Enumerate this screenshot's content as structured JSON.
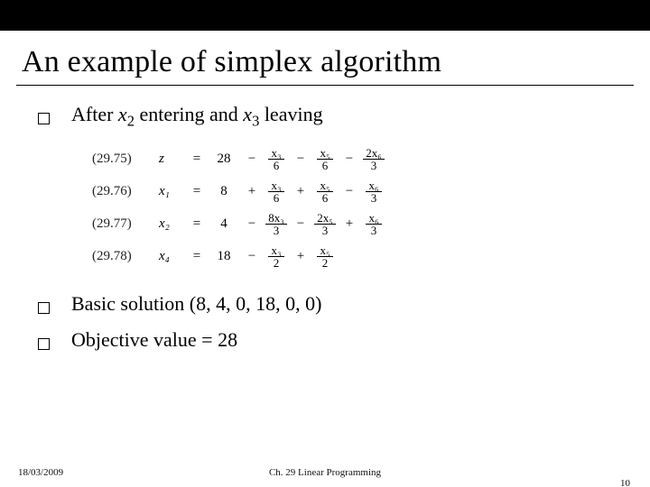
{
  "title": "An example of simplex algorithm",
  "bullets": {
    "b1_prefix": "After ",
    "b1_x2": "x",
    "b1_x2_sub": "2",
    "b1_mid": " entering and   ",
    "b1_x3": "x",
    "b1_x3_sub": "3",
    "b1_suffix": "   leaving",
    "b2": "Basic solution (8, 4, 0, 18, 0, 0)",
    "b3": "Objective value = 28"
  },
  "equations": [
    {
      "label": "(29.75)",
      "var": "z",
      "const": "28",
      "terms": [
        {
          "op": "−",
          "num": "x₃",
          "den": "6"
        },
        {
          "op": "−",
          "num": "x₅",
          "den": "6"
        },
        {
          "op": "−",
          "num": "2x₆",
          "den": "3"
        }
      ]
    },
    {
      "label": "(29.76)",
      "var": "x₁",
      "const": "8",
      "terms": [
        {
          "op": "+",
          "num": "x₃",
          "den": "6"
        },
        {
          "op": "+",
          "num": "x₅",
          "den": "6"
        },
        {
          "op": "−",
          "num": "x₆",
          "den": "3"
        }
      ]
    },
    {
      "label": "(29.77)",
      "var": "x₂",
      "const": "4",
      "terms": [
        {
          "op": "−",
          "num": "8x₃",
          "den": "3"
        },
        {
          "op": "−",
          "num": "2x₅",
          "den": "3"
        },
        {
          "op": "+",
          "num": "x₆",
          "den": "3"
        }
      ]
    },
    {
      "label": "(29.78)",
      "var": "x₄",
      "const": "18",
      "terms": [
        {
          "op": "−",
          "num": "x₃",
          "den": "2"
        },
        {
          "op": "+",
          "num": "x₅",
          "den": "2"
        },
        {
          "op": "",
          "num": "",
          "den": ""
        }
      ]
    }
  ],
  "footer": {
    "date": "18/03/2009",
    "center": "Ch. 29 Linear Programming",
    "page": "10"
  }
}
